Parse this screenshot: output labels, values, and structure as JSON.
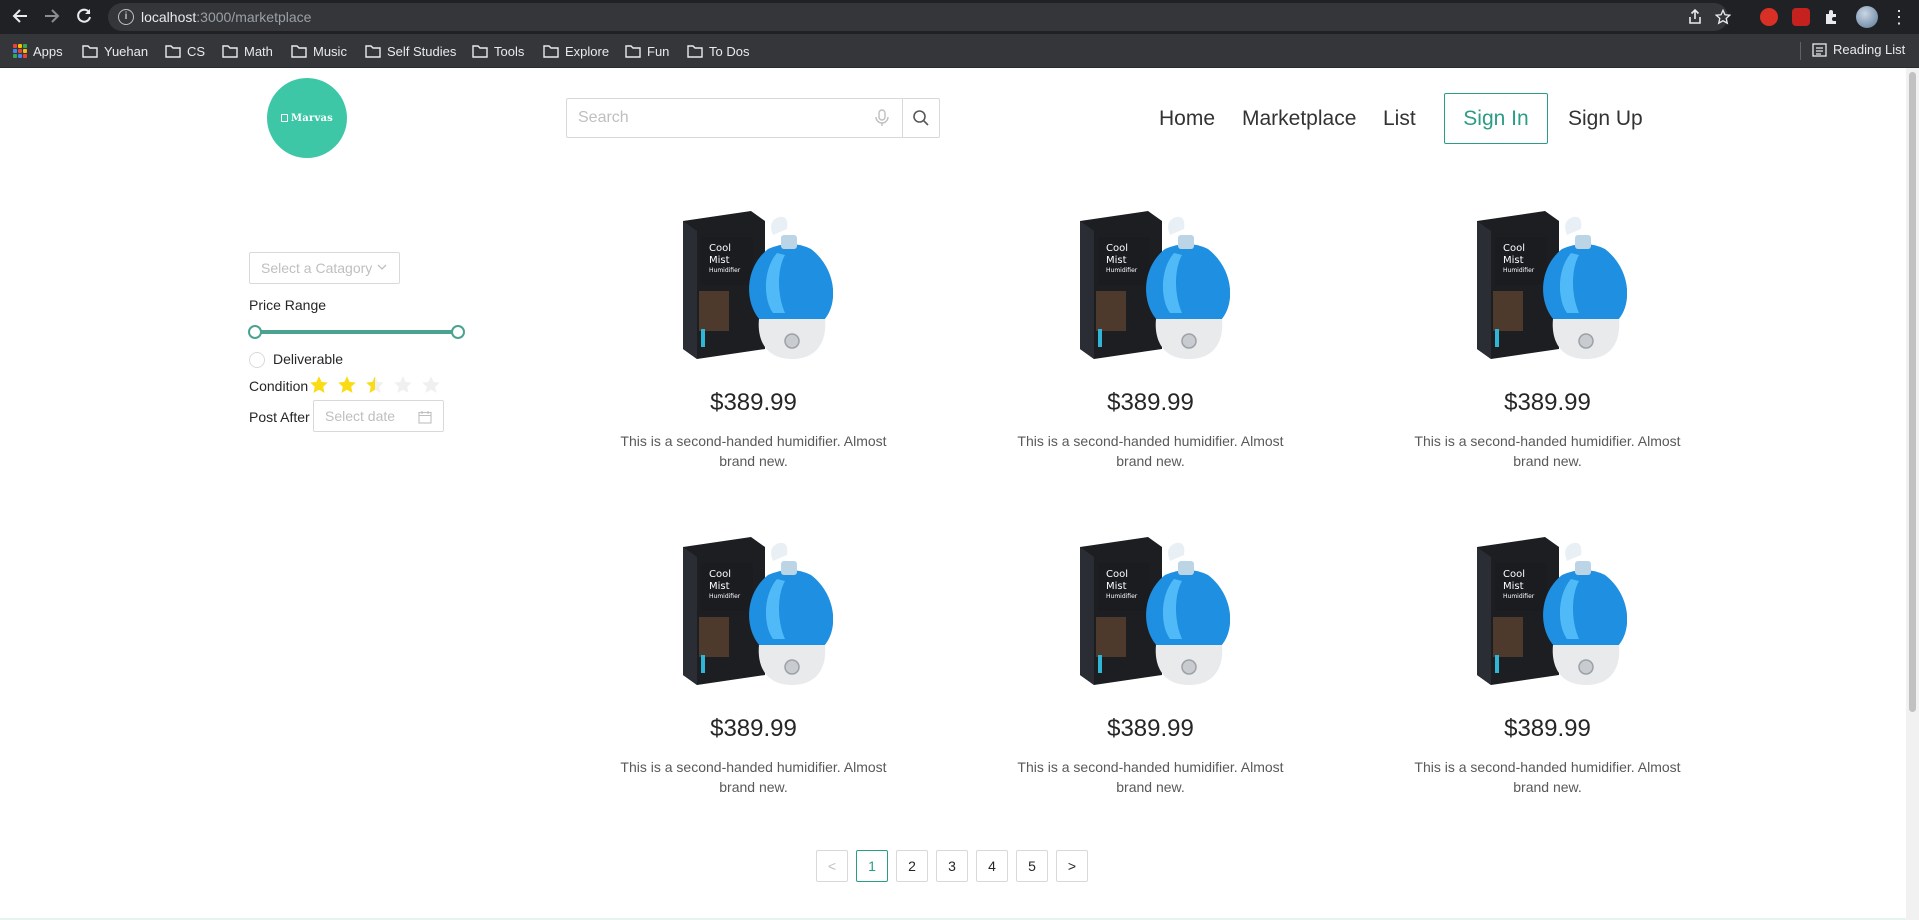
{
  "browser": {
    "url_host": "localhost",
    "url_path": ":3000/marketplace",
    "bookmarks": [
      "Apps",
      "Yuehan",
      "CS",
      "Math",
      "Music",
      "Self Studies",
      "Tools",
      "Explore",
      "Fun",
      "To Dos"
    ],
    "reading_list": "Reading List"
  },
  "site": {
    "logo_text": "Marvas",
    "search_placeholder": "Search",
    "nav": {
      "home": "Home",
      "marketplace": "Marketplace",
      "list": "List",
      "sign_in": "Sign In",
      "sign_up": "Sign Up"
    },
    "accent_color": "#2a9d84"
  },
  "filters": {
    "category_placeholder": "Select a Catagory",
    "price_range_label": "Price Range",
    "price_range": [
      0,
      100
    ],
    "deliverable_label": "Deliverable",
    "deliverable_checked": false,
    "condition_label": "Condition",
    "condition_rating": 2.5,
    "condition_max": 5,
    "post_after_label": "Post After",
    "date_placeholder": "Select date"
  },
  "products": [
    {
      "price": "$389.99",
      "desc_line1": "This is a second-handed humidifier. Almost",
      "desc_line2": "brand new."
    },
    {
      "price": "$389.99",
      "desc_line1": "This is a second-handed humidifier. Almost",
      "desc_line2": "brand new."
    },
    {
      "price": "$389.99",
      "desc_line1": "This is a second-handed humidifier. Almost",
      "desc_line2": "brand new."
    },
    {
      "price": "$389.99",
      "desc_line1": "This is a second-handed humidifier. Almost",
      "desc_line2": "brand new."
    },
    {
      "price": "$389.99",
      "desc_line1": "This is a second-handed humidifier. Almost",
      "desc_line2": "brand new."
    },
    {
      "price": "$389.99",
      "desc_line1": "This is a second-handed humidifier. Almost",
      "desc_line2": "brand new."
    }
  ],
  "pagination": {
    "prev": "<",
    "next": ">",
    "pages": [
      "1",
      "2",
      "3",
      "4",
      "5"
    ],
    "current": "1"
  }
}
